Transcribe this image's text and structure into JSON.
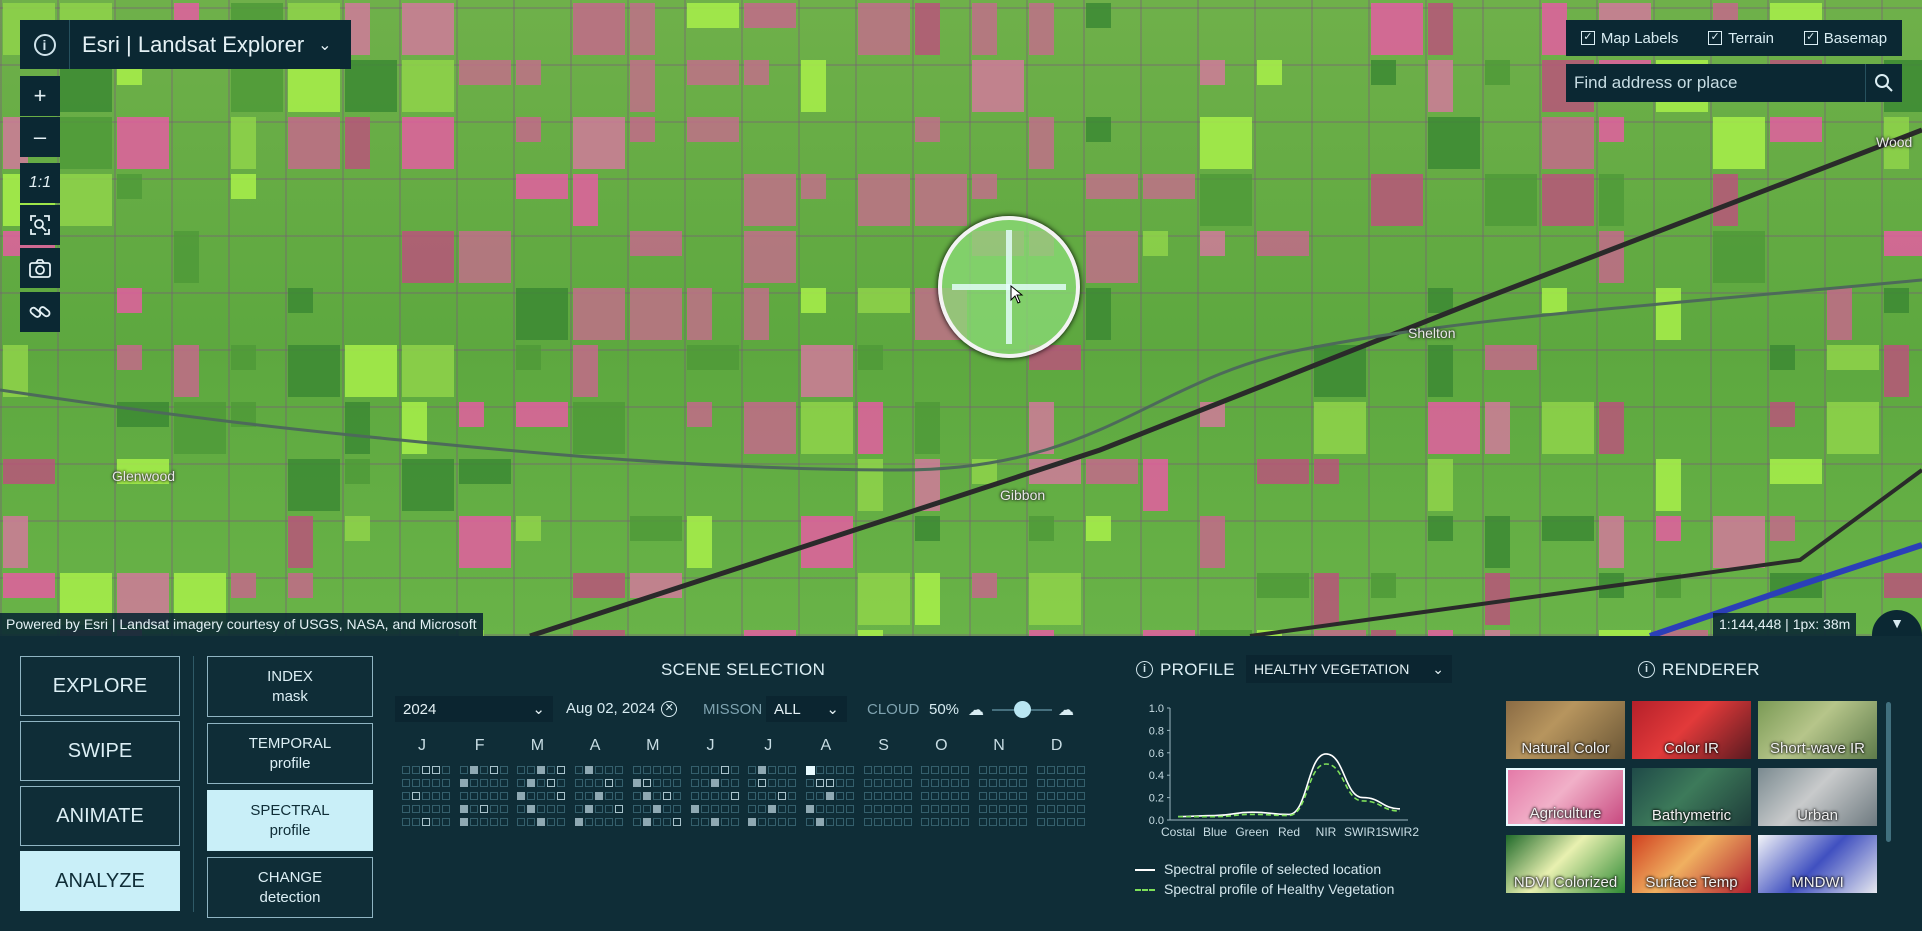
{
  "app": {
    "title": "Esri | Landsat Explorer"
  },
  "map_tools": {
    "zoom_in": "+",
    "zoom_out": "–",
    "one_to_one": "1:1"
  },
  "layers": {
    "map_labels": "Map Labels",
    "terrain": "Terrain",
    "basemap": "Basemap",
    "checked": [
      true,
      true,
      true
    ]
  },
  "search": {
    "placeholder": "Find address or place"
  },
  "towns": {
    "glenwood": "Glenwood",
    "gibbon": "Gibbon",
    "shelton": "Shelton",
    "wood": "Wood"
  },
  "attribution": "Powered by Esri | Landsat imagery courtesy of USGS, NASA, and Microsoft",
  "scale": "1:144,448 | 1px: 38m",
  "modes": {
    "explore": "EXPLORE",
    "swipe": "SWIPE",
    "animate": "ANIMATE",
    "analyze": "ANALYZE"
  },
  "tools": {
    "index": {
      "line1": "INDEX",
      "line2": "mask"
    },
    "temporal": {
      "line1": "TEMPORAL",
      "line2": "profile"
    },
    "spectral": {
      "line1": "SPECTRAL",
      "line2": "profile"
    },
    "change": {
      "line1": "CHANGE",
      "line2": "detection"
    }
  },
  "scene_selection": {
    "title": "SCENE SELECTION",
    "year": "2024",
    "date": "Aug 02, 2024",
    "mission_label": "MISSON",
    "mission_value": "ALL",
    "cloud_label": "CLOUD",
    "cloud_value": "50%",
    "cloud_fraction": 0.5,
    "months": [
      "J",
      "F",
      "M",
      "A",
      "M",
      "J",
      "J",
      "A",
      "S",
      "O",
      "N",
      "D"
    ]
  },
  "profile": {
    "title": "PROFILE",
    "type": "HEALTHY VEGETATION",
    "legend_selected": "Spectral profile of selected location",
    "legend_healthy": "Spectral profile of Healthy Vegetation"
  },
  "chart_data": {
    "type": "line",
    "categories": [
      "Costal",
      "Blue",
      "Green",
      "Red",
      "NIR",
      "SWIR1",
      "SWIR2"
    ],
    "ylim": [
      0,
      1.0
    ],
    "yticks": [
      "0.0",
      "0.2",
      "0.4",
      "0.6",
      "0.8",
      "1.0"
    ],
    "series": [
      {
        "name": "Spectral profile of selected location",
        "values": [
          0.03,
          0.04,
          0.07,
          0.05,
          0.59,
          0.2,
          0.1
        ],
        "color": "#ffffff"
      },
      {
        "name": "Spectral profile of Healthy Vegetation",
        "values": [
          0.03,
          0.03,
          0.05,
          0.04,
          0.5,
          0.17,
          0.08
        ],
        "color": "#7ee05a"
      }
    ]
  },
  "renderer": {
    "title": "RENDERER",
    "items": [
      "Natural Color",
      "Color IR",
      "Short-wave IR",
      "Agriculture",
      "Bathymetric",
      "Urban",
      "NDVI Colorized",
      "Surface Temp",
      "MNDWI"
    ],
    "selected": "Agriculture"
  }
}
